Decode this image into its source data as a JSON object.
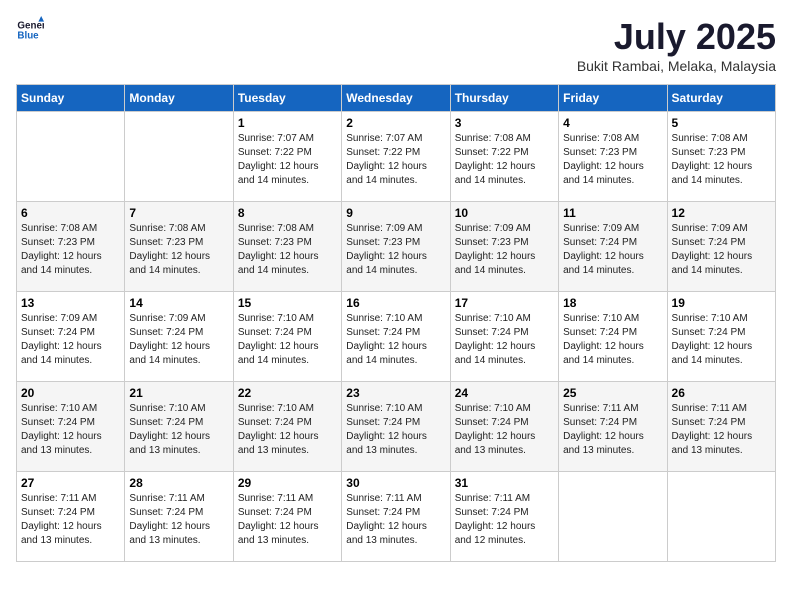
{
  "header": {
    "logo_general": "General",
    "logo_blue": "Blue",
    "month_title": "July 2025",
    "location": "Bukit Rambai, Melaka, Malaysia"
  },
  "weekdays": [
    "Sunday",
    "Monday",
    "Tuesday",
    "Wednesday",
    "Thursday",
    "Friday",
    "Saturday"
  ],
  "weeks": [
    [
      {
        "day": "",
        "sunrise": "",
        "sunset": "",
        "daylight": ""
      },
      {
        "day": "",
        "sunrise": "",
        "sunset": "",
        "daylight": ""
      },
      {
        "day": "1",
        "sunrise": "Sunrise: 7:07 AM",
        "sunset": "Sunset: 7:22 PM",
        "daylight": "Daylight: 12 hours and 14 minutes."
      },
      {
        "day": "2",
        "sunrise": "Sunrise: 7:07 AM",
        "sunset": "Sunset: 7:22 PM",
        "daylight": "Daylight: 12 hours and 14 minutes."
      },
      {
        "day": "3",
        "sunrise": "Sunrise: 7:08 AM",
        "sunset": "Sunset: 7:22 PM",
        "daylight": "Daylight: 12 hours and 14 minutes."
      },
      {
        "day": "4",
        "sunrise": "Sunrise: 7:08 AM",
        "sunset": "Sunset: 7:23 PM",
        "daylight": "Daylight: 12 hours and 14 minutes."
      },
      {
        "day": "5",
        "sunrise": "Sunrise: 7:08 AM",
        "sunset": "Sunset: 7:23 PM",
        "daylight": "Daylight: 12 hours and 14 minutes."
      }
    ],
    [
      {
        "day": "6",
        "sunrise": "Sunrise: 7:08 AM",
        "sunset": "Sunset: 7:23 PM",
        "daylight": "Daylight: 12 hours and 14 minutes."
      },
      {
        "day": "7",
        "sunrise": "Sunrise: 7:08 AM",
        "sunset": "Sunset: 7:23 PM",
        "daylight": "Daylight: 12 hours and 14 minutes."
      },
      {
        "day": "8",
        "sunrise": "Sunrise: 7:08 AM",
        "sunset": "Sunset: 7:23 PM",
        "daylight": "Daylight: 12 hours and 14 minutes."
      },
      {
        "day": "9",
        "sunrise": "Sunrise: 7:09 AM",
        "sunset": "Sunset: 7:23 PM",
        "daylight": "Daylight: 12 hours and 14 minutes."
      },
      {
        "day": "10",
        "sunrise": "Sunrise: 7:09 AM",
        "sunset": "Sunset: 7:23 PM",
        "daylight": "Daylight: 12 hours and 14 minutes."
      },
      {
        "day": "11",
        "sunrise": "Sunrise: 7:09 AM",
        "sunset": "Sunset: 7:24 PM",
        "daylight": "Daylight: 12 hours and 14 minutes."
      },
      {
        "day": "12",
        "sunrise": "Sunrise: 7:09 AM",
        "sunset": "Sunset: 7:24 PM",
        "daylight": "Daylight: 12 hours and 14 minutes."
      }
    ],
    [
      {
        "day": "13",
        "sunrise": "Sunrise: 7:09 AM",
        "sunset": "Sunset: 7:24 PM",
        "daylight": "Daylight: 12 hours and 14 minutes."
      },
      {
        "day": "14",
        "sunrise": "Sunrise: 7:09 AM",
        "sunset": "Sunset: 7:24 PM",
        "daylight": "Daylight: 12 hours and 14 minutes."
      },
      {
        "day": "15",
        "sunrise": "Sunrise: 7:10 AM",
        "sunset": "Sunset: 7:24 PM",
        "daylight": "Daylight: 12 hours and 14 minutes."
      },
      {
        "day": "16",
        "sunrise": "Sunrise: 7:10 AM",
        "sunset": "Sunset: 7:24 PM",
        "daylight": "Daylight: 12 hours and 14 minutes."
      },
      {
        "day": "17",
        "sunrise": "Sunrise: 7:10 AM",
        "sunset": "Sunset: 7:24 PM",
        "daylight": "Daylight: 12 hours and 14 minutes."
      },
      {
        "day": "18",
        "sunrise": "Sunrise: 7:10 AM",
        "sunset": "Sunset: 7:24 PM",
        "daylight": "Daylight: 12 hours and 14 minutes."
      },
      {
        "day": "19",
        "sunrise": "Sunrise: 7:10 AM",
        "sunset": "Sunset: 7:24 PM",
        "daylight": "Daylight: 12 hours and 14 minutes."
      }
    ],
    [
      {
        "day": "20",
        "sunrise": "Sunrise: 7:10 AM",
        "sunset": "Sunset: 7:24 PM",
        "daylight": "Daylight: 12 hours and 13 minutes."
      },
      {
        "day": "21",
        "sunrise": "Sunrise: 7:10 AM",
        "sunset": "Sunset: 7:24 PM",
        "daylight": "Daylight: 12 hours and 13 minutes."
      },
      {
        "day": "22",
        "sunrise": "Sunrise: 7:10 AM",
        "sunset": "Sunset: 7:24 PM",
        "daylight": "Daylight: 12 hours and 13 minutes."
      },
      {
        "day": "23",
        "sunrise": "Sunrise: 7:10 AM",
        "sunset": "Sunset: 7:24 PM",
        "daylight": "Daylight: 12 hours and 13 minutes."
      },
      {
        "day": "24",
        "sunrise": "Sunrise: 7:10 AM",
        "sunset": "Sunset: 7:24 PM",
        "daylight": "Daylight: 12 hours and 13 minutes."
      },
      {
        "day": "25",
        "sunrise": "Sunrise: 7:11 AM",
        "sunset": "Sunset: 7:24 PM",
        "daylight": "Daylight: 12 hours and 13 minutes."
      },
      {
        "day": "26",
        "sunrise": "Sunrise: 7:11 AM",
        "sunset": "Sunset: 7:24 PM",
        "daylight": "Daylight: 12 hours and 13 minutes."
      }
    ],
    [
      {
        "day": "27",
        "sunrise": "Sunrise: 7:11 AM",
        "sunset": "Sunset: 7:24 PM",
        "daylight": "Daylight: 12 hours and 13 minutes."
      },
      {
        "day": "28",
        "sunrise": "Sunrise: 7:11 AM",
        "sunset": "Sunset: 7:24 PM",
        "daylight": "Daylight: 12 hours and 13 minutes."
      },
      {
        "day": "29",
        "sunrise": "Sunrise: 7:11 AM",
        "sunset": "Sunset: 7:24 PM",
        "daylight": "Daylight: 12 hours and 13 minutes."
      },
      {
        "day": "30",
        "sunrise": "Sunrise: 7:11 AM",
        "sunset": "Sunset: 7:24 PM",
        "daylight": "Daylight: 12 hours and 13 minutes."
      },
      {
        "day": "31",
        "sunrise": "Sunrise: 7:11 AM",
        "sunset": "Sunset: 7:24 PM",
        "daylight": "Daylight: 12 hours and 12 minutes."
      },
      {
        "day": "",
        "sunrise": "",
        "sunset": "",
        "daylight": ""
      },
      {
        "day": "",
        "sunrise": "",
        "sunset": "",
        "daylight": ""
      }
    ]
  ]
}
